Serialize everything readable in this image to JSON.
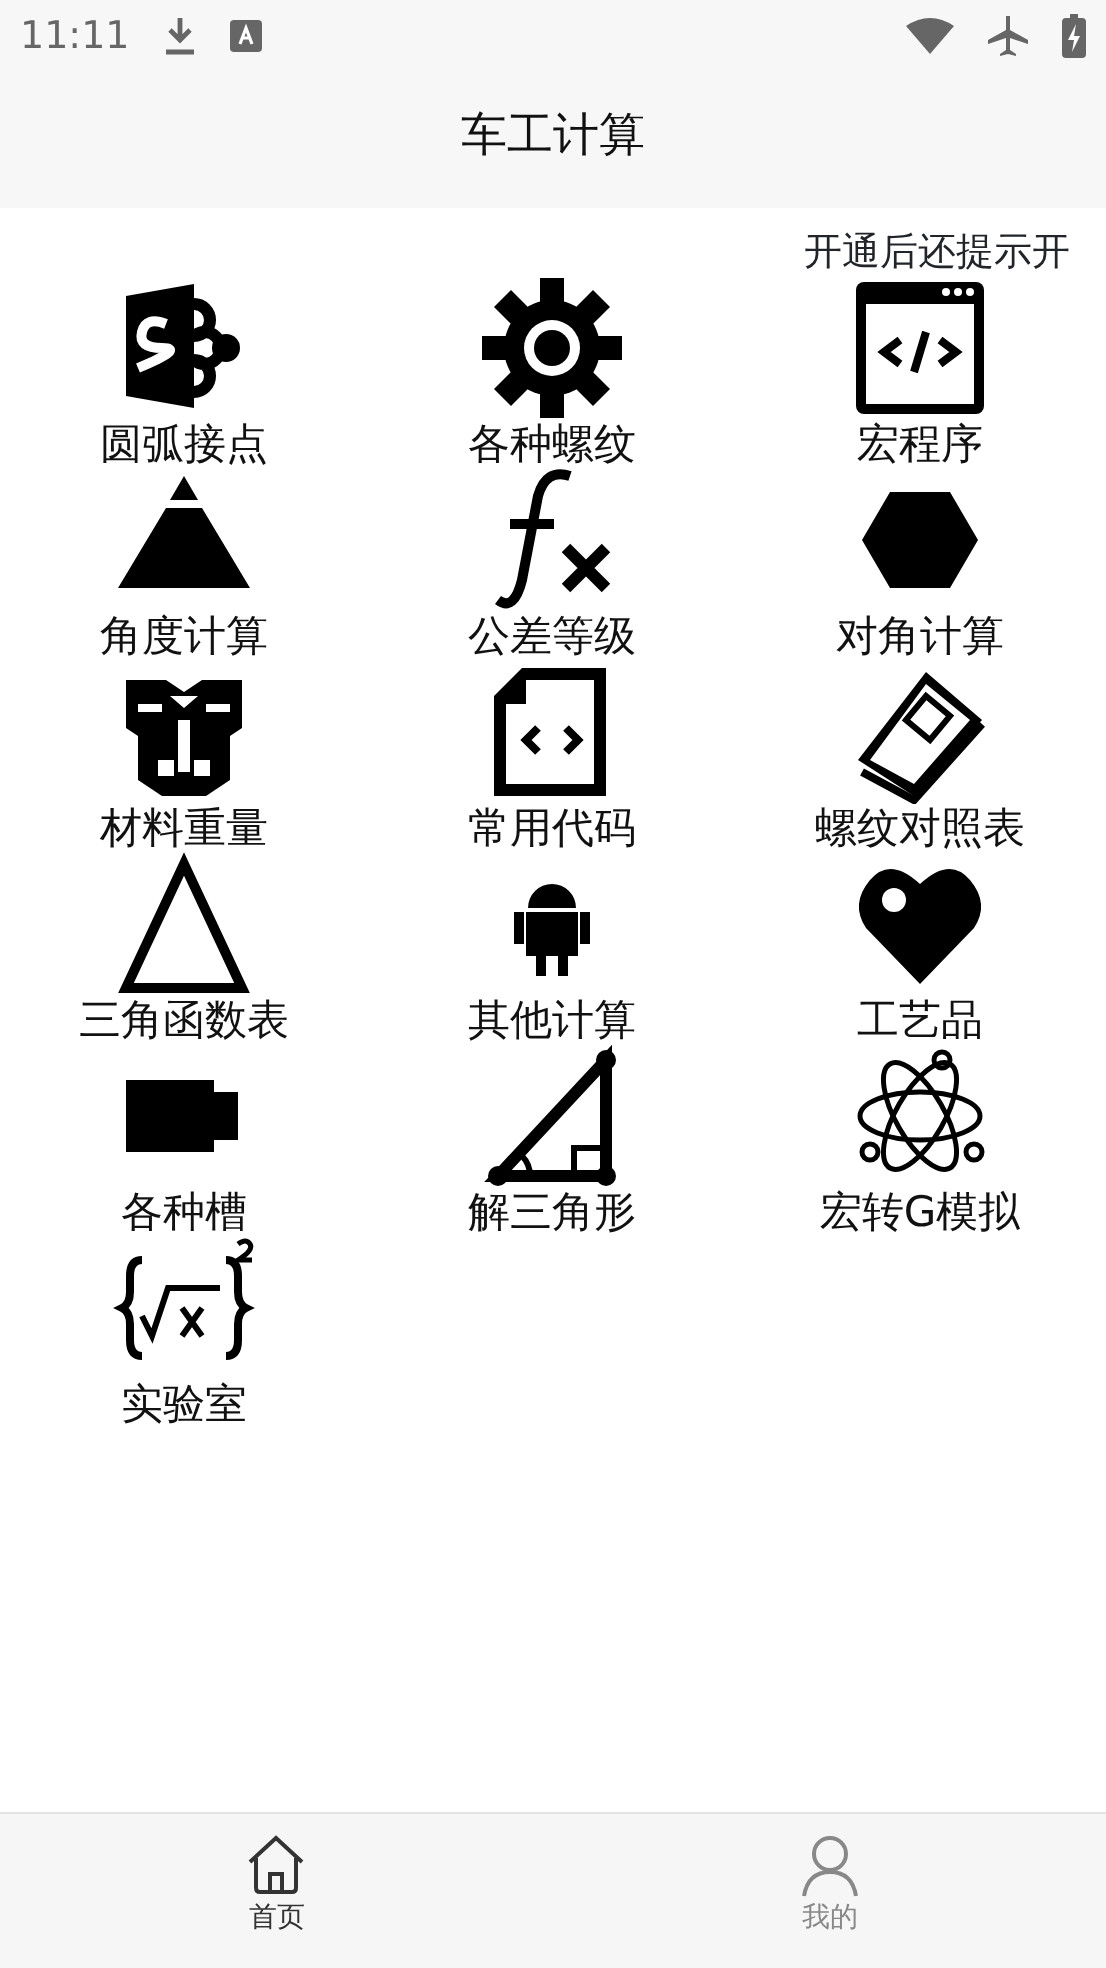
{
  "status_bar": {
    "time": "11:11"
  },
  "header": {
    "title": "车工计算"
  },
  "notice": "开通后还提示开",
  "tools": [
    {
      "label": "圆弧接点"
    },
    {
      "label": "各种螺纹"
    },
    {
      "label": "宏程序"
    },
    {
      "label": "角度计算"
    },
    {
      "label": "公差等级"
    },
    {
      "label": "对角计算"
    },
    {
      "label": "材料重量"
    },
    {
      "label": "常用代码"
    },
    {
      "label": "螺纹对照表"
    },
    {
      "label": "三角函数表"
    },
    {
      "label": "其他计算"
    },
    {
      "label": "工艺品"
    },
    {
      "label": "各种槽"
    },
    {
      "label": "解三角形"
    },
    {
      "label": "宏转G模拟"
    },
    {
      "label": "实验室"
    }
  ],
  "bottom_nav": [
    {
      "label": "首页",
      "selected": true
    },
    {
      "label": "我的",
      "selected": false
    }
  ]
}
